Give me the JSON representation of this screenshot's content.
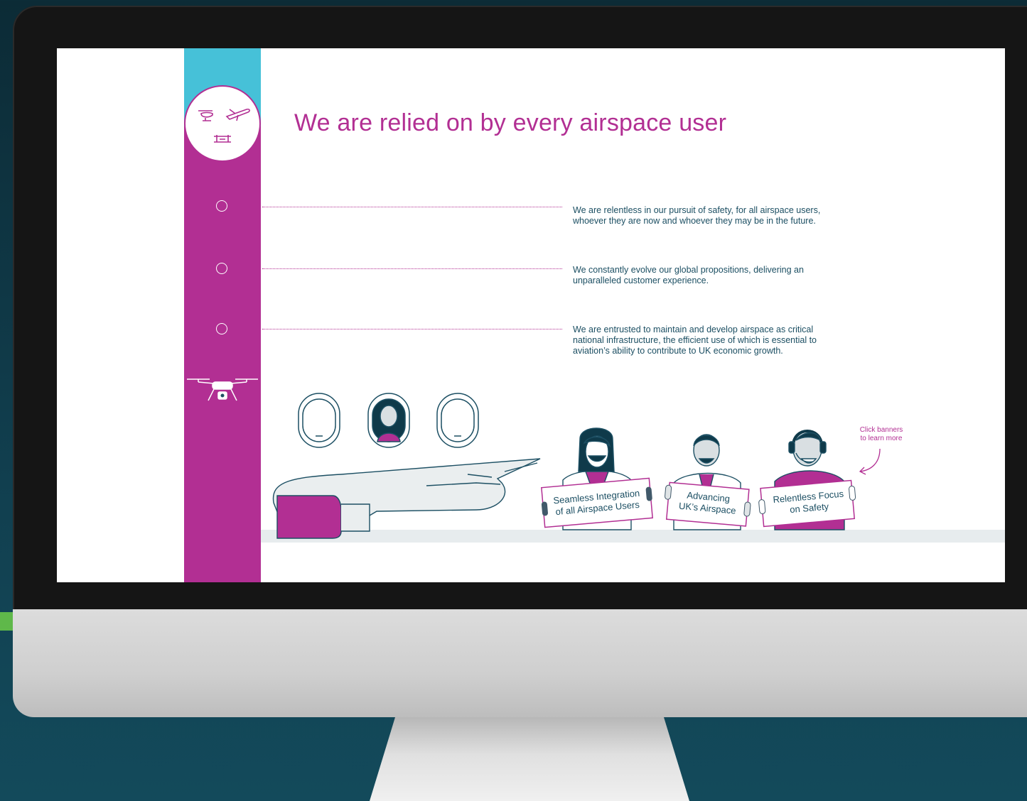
{
  "page": {
    "title": "We are relied on by every airspace user"
  },
  "statements": [
    {
      "line1": "We are relentless in our pursuit of safety, for all airspace users,",
      "line2": "whoever they are now and whoever they may be in the future.",
      "line3": ""
    },
    {
      "line1": "We constantly evolve our global propositions, delivering an",
      "line2": "unparalleled customer experience.",
      "line3": ""
    },
    {
      "line1": "We are entrusted to maintain and develop airspace as critical",
      "line2": "national infrastructure, the efficient use of which is essential to",
      "line3": "aviation’s ability to contribute to UK economic growth."
    }
  ],
  "hint": {
    "line1": "Click banners",
    "line2": "to learn more"
  },
  "banners": [
    {
      "line1": "Seamless Integration",
      "line2": "of all Airspace Users"
    },
    {
      "line1": "Advancing",
      "line2": "UK’s Airspace"
    },
    {
      "line1": "Relentless Focus",
      "line2": "on Safety"
    }
  ],
  "icons": [
    "helicopter-icon",
    "plane-icon",
    "drone-icon"
  ],
  "colors": {
    "magenta": "#b22f93",
    "cyan": "#46c1d8",
    "navy": "#1c4f63",
    "dark_teal": "#0c2b36"
  }
}
